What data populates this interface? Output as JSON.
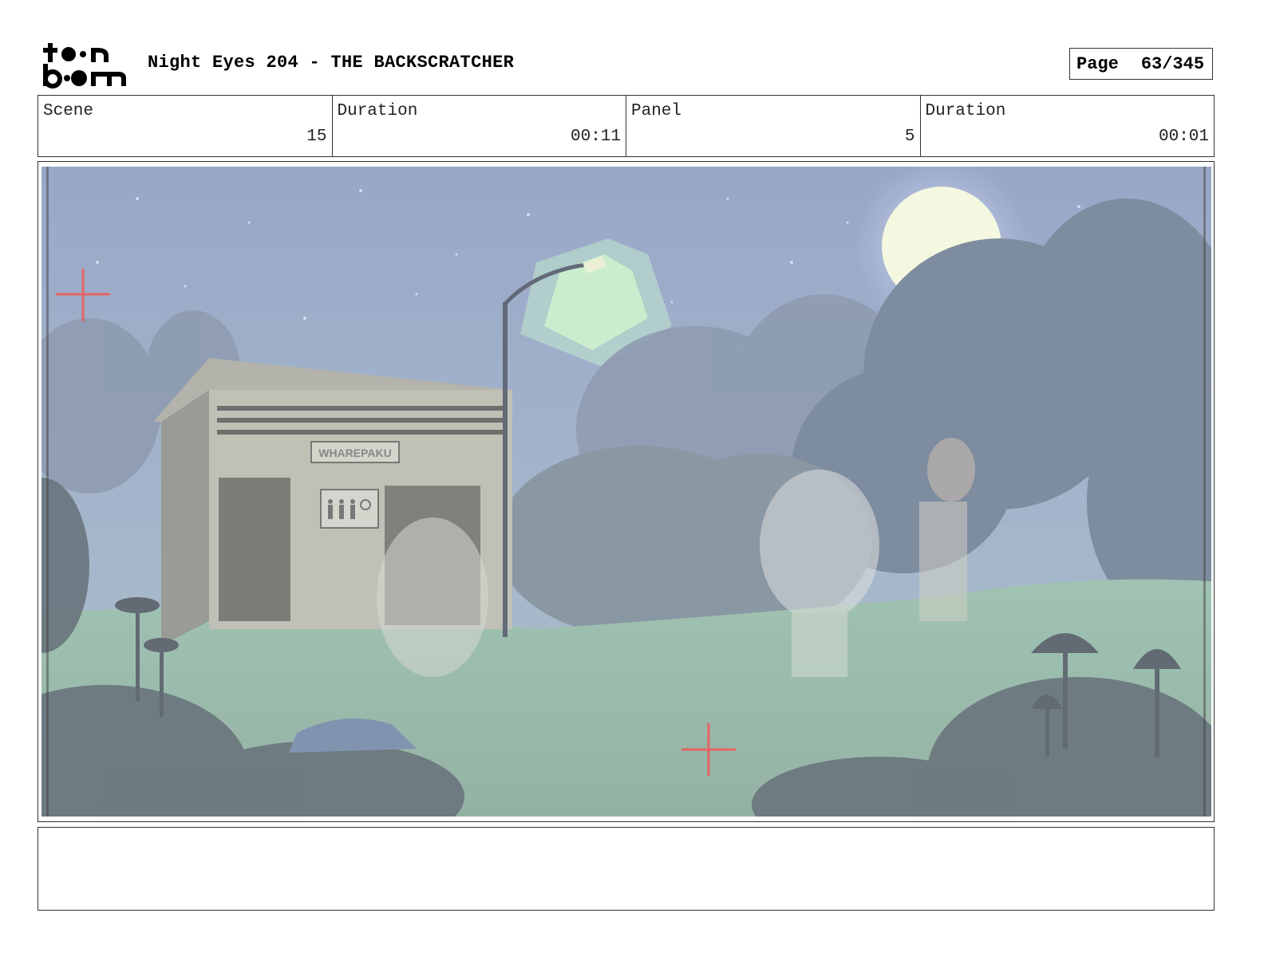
{
  "header": {
    "logo_text_top": "toon",
    "logo_text_bottom": "boom",
    "title": "Night Eyes 204 - THE BACKSCRATCHER",
    "page_label": "Page",
    "page_value": "63/345"
  },
  "info": {
    "scene_label": "Scene",
    "scene_value": "15",
    "scene_duration_label": "Duration",
    "scene_duration_value": "00:11",
    "panel_label": "Panel",
    "panel_value": "5",
    "panel_duration_label": "Duration",
    "panel_duration_value": "00:01"
  },
  "panel": {
    "sign_text": "WHAREPAKU",
    "colors": {
      "sky": "#8fa3c4",
      "moon": "#f4f7dc",
      "grass": "#8fb3a3",
      "trees": "#6f7f92",
      "crosshair": "#e05050"
    }
  },
  "notes": {
    "text": ""
  }
}
